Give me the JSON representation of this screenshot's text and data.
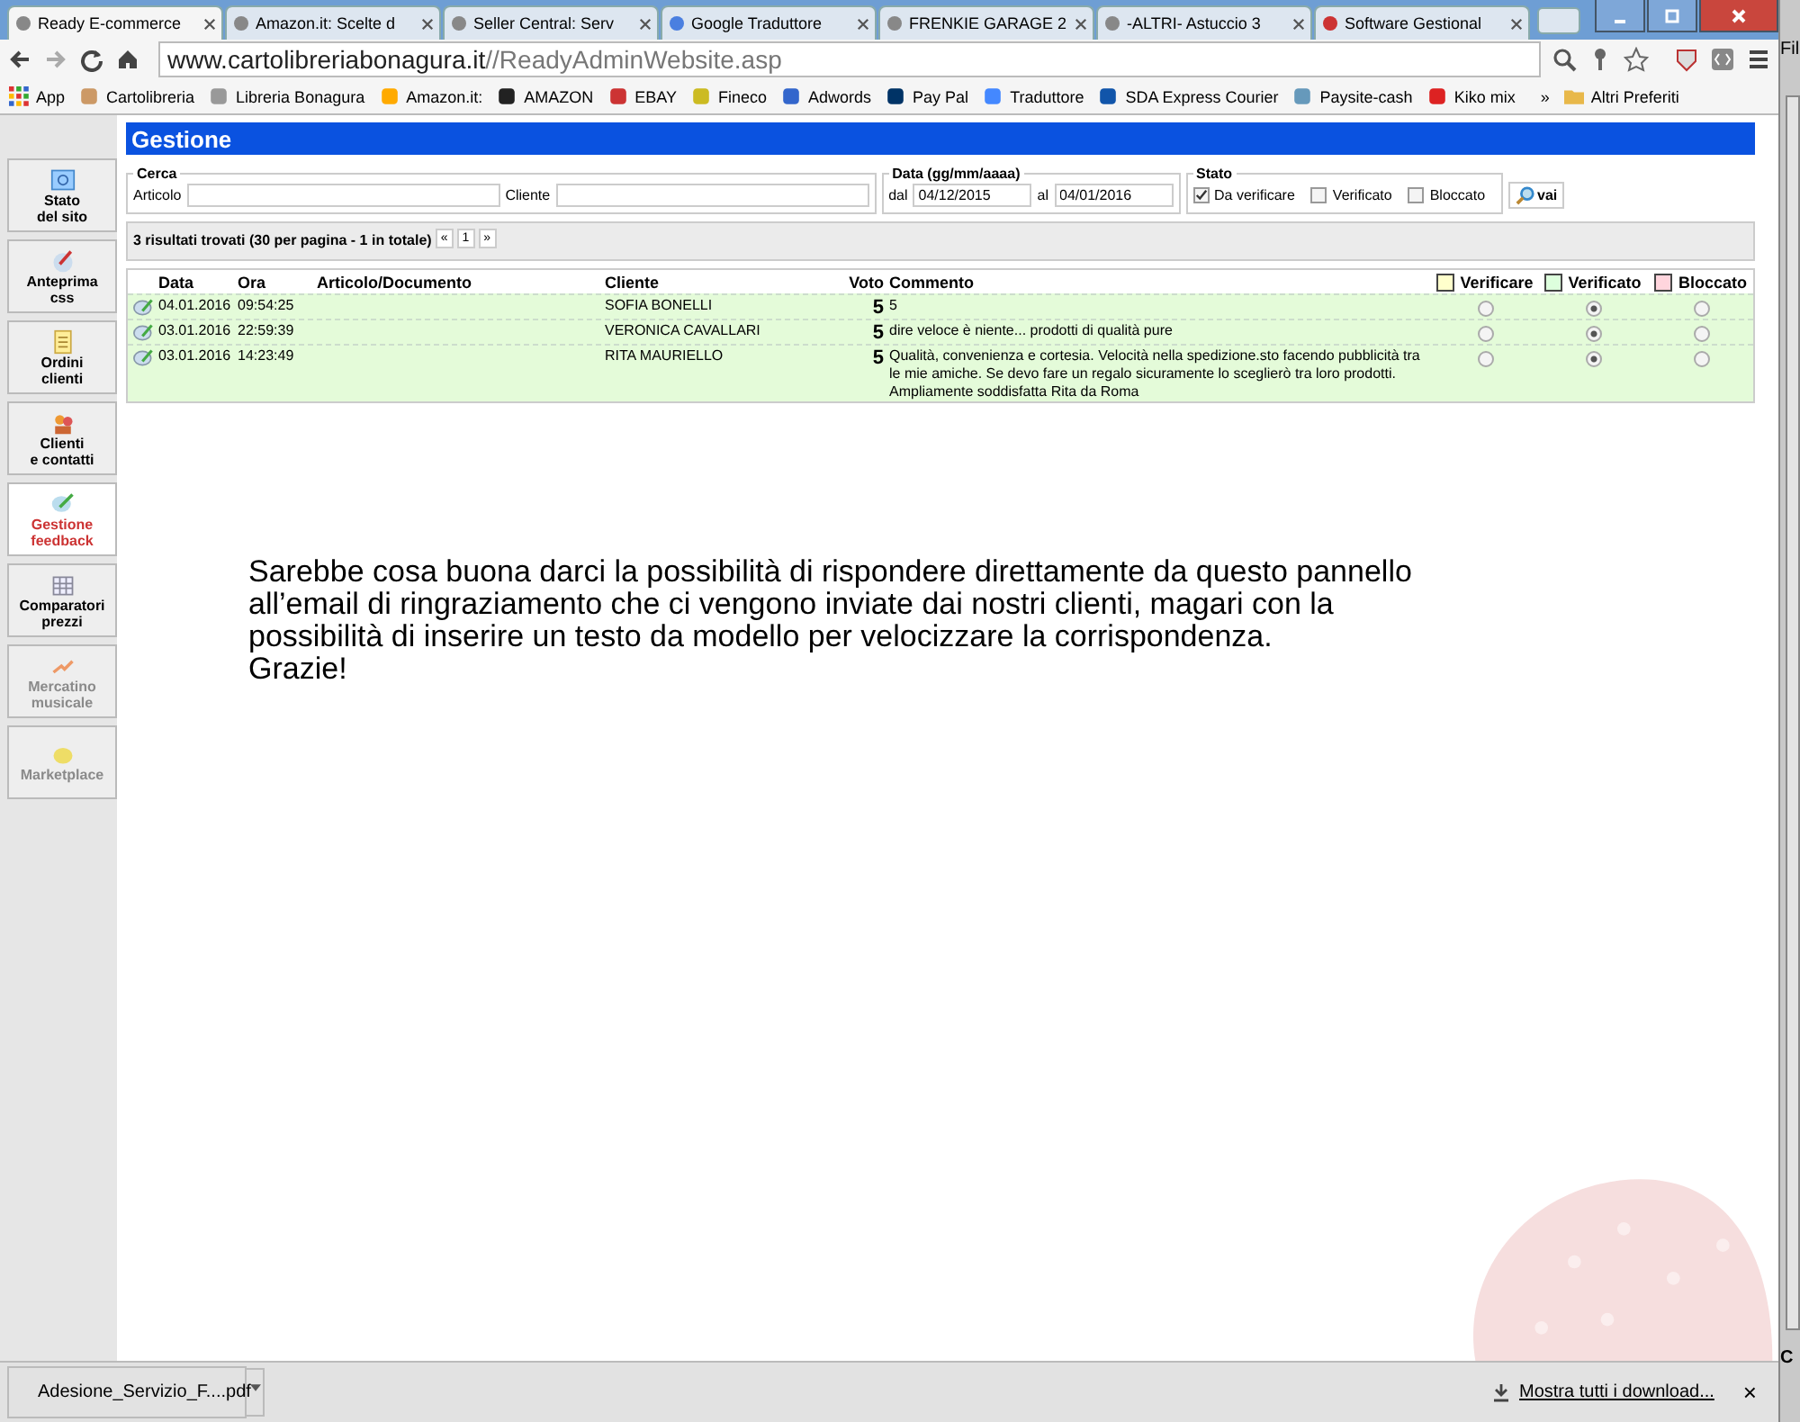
{
  "browser": {
    "tabs": [
      {
        "title": "Ready E-commerce",
        "selected": true
      },
      {
        "title": "Amazon.it: Scelte d",
        "selected": false
      },
      {
        "title": "Seller Central: Serv",
        "selected": false
      },
      {
        "title": "Google Traduttore",
        "selected": false
      },
      {
        "title": "FRENKIE GARAGE 2",
        "selected": false
      },
      {
        "title": "-ALTRI- Astuccio 3",
        "selected": false
      },
      {
        "title": "Software Gestional",
        "selected": false
      }
    ],
    "address": {
      "host": "www.cartolibreriabonagura.it",
      "path": "//ReadyAdminWebsite.asp"
    },
    "apps_label": "App",
    "bookmarks": [
      {
        "label": "Cartolibreria"
      },
      {
        "label": "Libreria Bonagura"
      },
      {
        "label": "Amazon.it:"
      },
      {
        "label": "AMAZON"
      },
      {
        "label": "EBAY"
      },
      {
        "label": "Fineco"
      },
      {
        "label": "Adwords"
      },
      {
        "label": "Pay Pal"
      },
      {
        "label": "Traduttore"
      },
      {
        "label": "SDA Express Courier"
      },
      {
        "label": "Paysite-cash"
      },
      {
        "label": "Kiko mix"
      }
    ],
    "more": "»",
    "other_bookmarks": "Altri Preferiti"
  },
  "page": {
    "header": "Gestione",
    "sidebar": [
      {
        "label": "Stato\ndel sito",
        "selected": false,
        "disabled": false
      },
      {
        "label": "Anteprima\ncss",
        "selected": false,
        "disabled": false
      },
      {
        "label": "Ordini\nclienti",
        "selected": false,
        "disabled": false
      },
      {
        "label": "Clienti\ne contatti",
        "selected": false,
        "disabled": false
      },
      {
        "label": "Gestione\nfeedback",
        "selected": true,
        "disabled": false
      },
      {
        "label": "Comparatori\nprezzi",
        "selected": false,
        "disabled": false
      },
      {
        "label": "Mercatino\nmusicale",
        "selected": false,
        "disabled": true
      },
      {
        "label": "Marketplace",
        "selected": false,
        "disabled": true
      }
    ],
    "search": {
      "cerca": {
        "legend": "Cerca",
        "articolo_label": "Articolo",
        "cliente_label": "Cliente"
      },
      "data": {
        "legend": "Data (gg/mm/aaaa)",
        "from_label": "dal",
        "from_value": "04/12/2015",
        "to_label": "al",
        "to_value": "04/01/2016"
      },
      "stato": {
        "legend": "Stato",
        "options": [
          {
            "label": "Da verificare",
            "checked": true
          },
          {
            "label": "Verificato",
            "checked": false
          },
          {
            "label": "Bloccato",
            "checked": false
          }
        ]
      },
      "go_button": "vai"
    },
    "results": {
      "summary": "3 risultati trovati (30 per pagina - 1 in totale)",
      "pager": [
        "«",
        "1",
        "»"
      ]
    },
    "table": {
      "columns": [
        "Data",
        "Ora",
        "Articolo/Documento",
        "Cliente",
        "Voto",
        "Commento"
      ],
      "status_columns": [
        {
          "label": "Verificare",
          "color": "#ffffcc"
        },
        {
          "label": "Verificato",
          "color": "#ddffdd"
        },
        {
          "label": "Bloccato",
          "color": "#ffd5dd"
        }
      ],
      "rows": [
        {
          "date": "04.01.2016",
          "time": "09:54:25",
          "client": "SOFIA BONELLI",
          "vote": "5",
          "comment": "5",
          "status": [
            {
              "selected": false
            },
            {
              "selected": true
            },
            {
              "selected": false
            }
          ]
        },
        {
          "date": "03.01.2016",
          "time": "22:59:39",
          "client": "VERONICA CAVALLARI",
          "vote": "5",
          "comment": "dire veloce è niente... prodotti di qualità pure",
          "status": [
            {
              "selected": false
            },
            {
              "selected": true
            },
            {
              "selected": false
            }
          ]
        },
        {
          "date": "03.01.2016",
          "time": "14:23:49",
          "client": "RITA MAURIELLO",
          "vote": "5",
          "comment": "Qualità, convenienza e cortesia. Velocità nella spedizione.sto facendo pubblicità tra le mie amiche. Se devo fare un regalo sicuramente lo sceglierò tra loro prodotti. Ampliamente soddisfatta Rita da Roma",
          "status": [
            {
              "selected": false
            },
            {
              "selected": true
            },
            {
              "selected": false
            }
          ]
        }
      ]
    },
    "note": "Sarebbe cosa buona darci la possibilità di rispondere direttamente da questo pannello\nall’email di ringraziamento che ci vengono inviate dai nostri clienti, magari con la\npossibilità di inserire un testo da modello per velocizzare la corrispondenza.\nGrazie!"
  },
  "right_window": {
    "top_text": "Fil",
    "bottom_text": "C"
  },
  "downloads": {
    "file": "Adesione_Servizio_F....pdf",
    "show_all": "Mostra tutti i download...",
    "close": "×"
  }
}
